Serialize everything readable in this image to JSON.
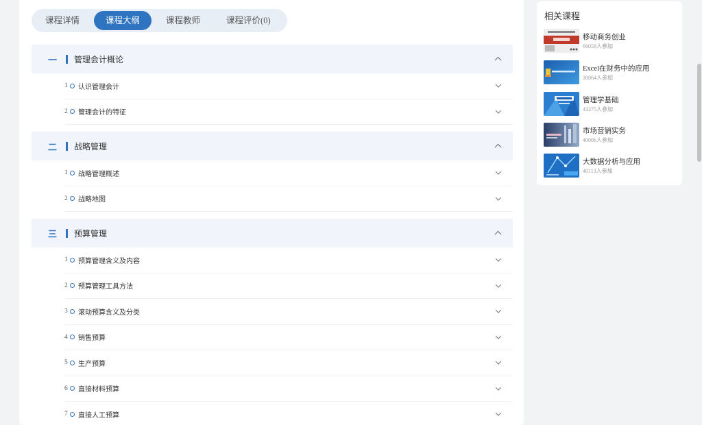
{
  "tabs": [
    {
      "label": "课程详情",
      "active": false
    },
    {
      "label": "课程大纲",
      "active": true
    },
    {
      "label": "课程教师",
      "active": false
    },
    {
      "label": "课程评价(0)",
      "active": false
    }
  ],
  "chapters": [
    {
      "num": "一",
      "title": "管理会计概论",
      "expanded": true,
      "lessons": [
        {
          "num": "1",
          "title": "认识管理会计"
        },
        {
          "num": "2",
          "title": "管理会计的特征"
        }
      ]
    },
    {
      "num": "二",
      "title": "战略管理",
      "expanded": true,
      "lessons": [
        {
          "num": "1",
          "title": "战略管理概述"
        },
        {
          "num": "2",
          "title": "战略地图"
        }
      ]
    },
    {
      "num": "三",
      "title": "预算管理",
      "expanded": true,
      "lessons": [
        {
          "num": "1",
          "title": "预算管理含义及内容"
        },
        {
          "num": "2",
          "title": "预算管理工具方法"
        },
        {
          "num": "3",
          "title": "滚动预算含义及分类"
        },
        {
          "num": "4",
          "title": "销售预算"
        },
        {
          "num": "5",
          "title": "生产预算"
        },
        {
          "num": "6",
          "title": "直接材料预算"
        },
        {
          "num": "7",
          "title": "直接人工预算"
        }
      ]
    }
  ],
  "sidebar": {
    "title": "相关课程",
    "courses": [
      {
        "name": "移动商务创业",
        "count": "66058人参加"
      },
      {
        "name": "Excel在财务中的应用",
        "count": "30864人参加"
      },
      {
        "name": "管理学基础",
        "count": "43275人参加"
      },
      {
        "name": "市场营销实务",
        "count": "40006人参加"
      },
      {
        "name": "大数据分析与应用",
        "count": "40113人参加"
      }
    ]
  }
}
